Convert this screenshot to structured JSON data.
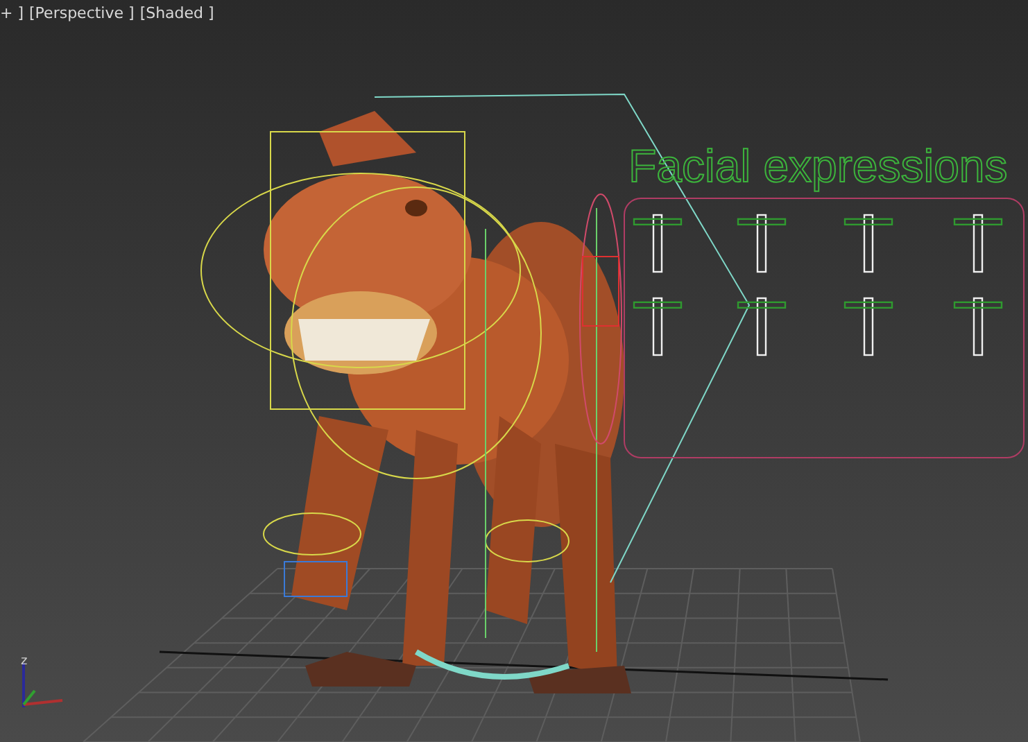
{
  "viewport": {
    "labels": [
      {
        "text": "+ ]"
      },
      {
        "text": "[Perspective ]"
      },
      {
        "text": "[Shaded ]"
      }
    ],
    "scene_title": "Facial expressions",
    "face_sliders": [
      {
        "level": 0.88
      },
      {
        "level": 0.88
      },
      {
        "level": 0.88
      },
      {
        "level": 0.88
      },
      {
        "level": 0.88
      },
      {
        "level": 0.88
      },
      {
        "level": 0.88
      },
      {
        "level": 0.88
      }
    ],
    "axis_label": "z"
  }
}
